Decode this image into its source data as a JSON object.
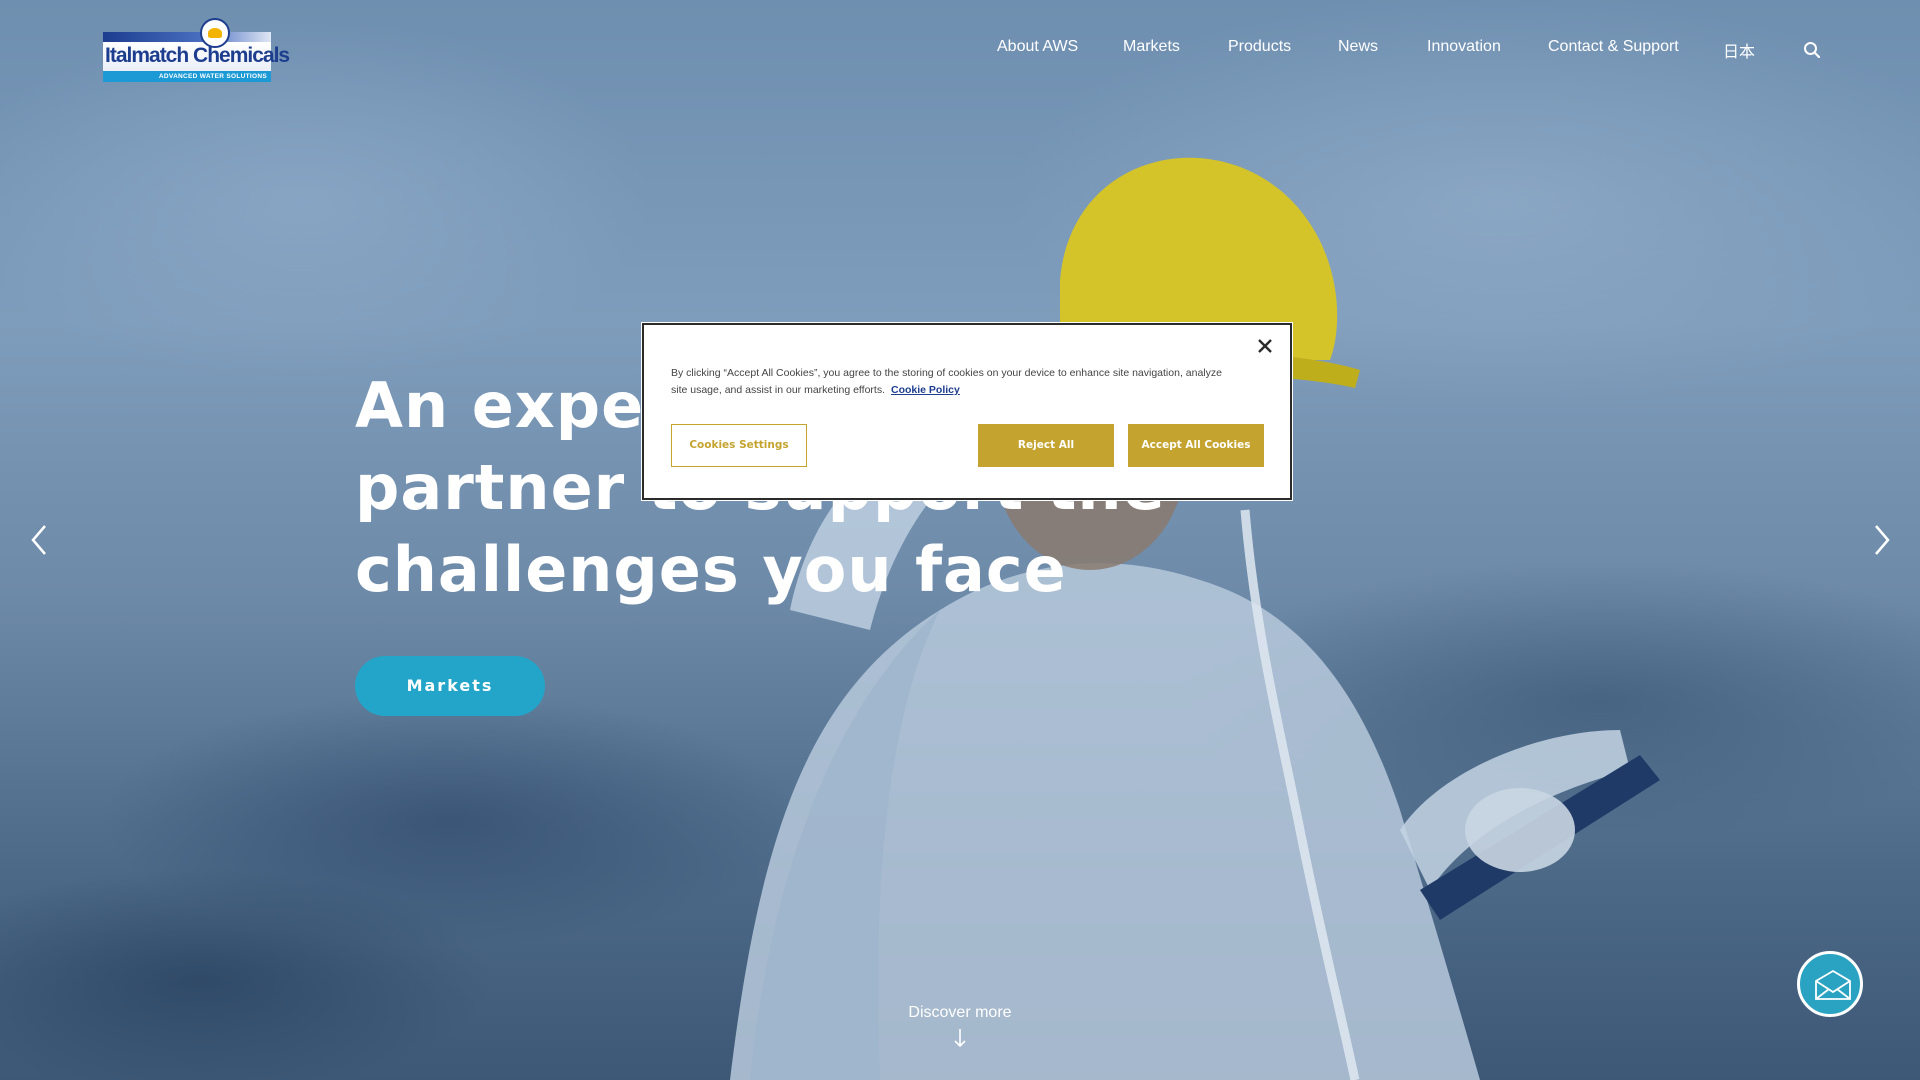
{
  "brand": {
    "name": "Italmatch Chemicals",
    "tagline": "ADVANCED WATER SOLUTIONS"
  },
  "nav": {
    "items": [
      {
        "label": "About AWS"
      },
      {
        "label": "Markets"
      },
      {
        "label": "Products"
      },
      {
        "label": "News"
      },
      {
        "label": "Innovation"
      },
      {
        "label": "Contact & Support"
      },
      {
        "label": "日本"
      }
    ],
    "search_icon": "search-icon"
  },
  "hero": {
    "headline_lines": [
      "An expert",
      "partner to support the",
      "challenges you face"
    ],
    "cta_label": "Markets",
    "discover_label": "Discover more",
    "accent_color": "#22a5c8"
  },
  "cookie": {
    "text": "By clicking “Accept All Cookies”, you agree to the storing of cookies on your device to enhance site navigation, analyze site usage, and assist in our marketing efforts.",
    "policy_link": "Cookie Policy",
    "settings_label": "Cookies Settings",
    "reject_label": "Reject All",
    "accept_label": "Accept All Cookies",
    "button_color": "#c4a42e"
  }
}
